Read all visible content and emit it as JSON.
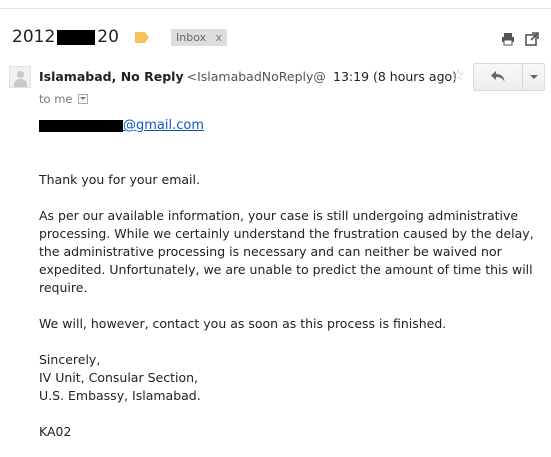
{
  "thread": {
    "subject_prefix": "2012",
    "subject_suffix": "20",
    "label_name": "Inbox",
    "label_remove": "x"
  },
  "message": {
    "sender_name": "Islamabad, No Reply",
    "sender_email": "<IslamabadNoReply@",
    "time": "13:19 (8 hours ago)",
    "to_label": "to me",
    "recipient_domain": "@gmail.com",
    "greeting": "Thank you for your email.",
    "paragraph_1": "As per our available information, your case is still undergoing administrative processing.  While we certainly understand the frustration caused by the delay, the administrative processing is necessary and can neither be waived nor expedited. Unfortunately, we are unable to predict the amount of time this will require.",
    "paragraph_2": "We will, however, contact you as soon as this process is finished.",
    "signoff": "Sincerely,",
    "sig_line_1": "IV Unit, Consular Section,",
    "sig_line_2": "U.S. Embassy, Islamabad.",
    "code": "KA02"
  },
  "icons": {
    "label_tag": "label-tag-icon",
    "print": "print-icon",
    "new_window": "new-window-icon",
    "avatar": "avatar-icon",
    "star": "star-icon",
    "reply": "reply-icon",
    "more": "more-options-icon",
    "details": "details-dropdown-icon"
  },
  "colors": {
    "label_tag": "#f4c35a",
    "link": "#1155cc",
    "chip_bg": "#dddddd"
  }
}
